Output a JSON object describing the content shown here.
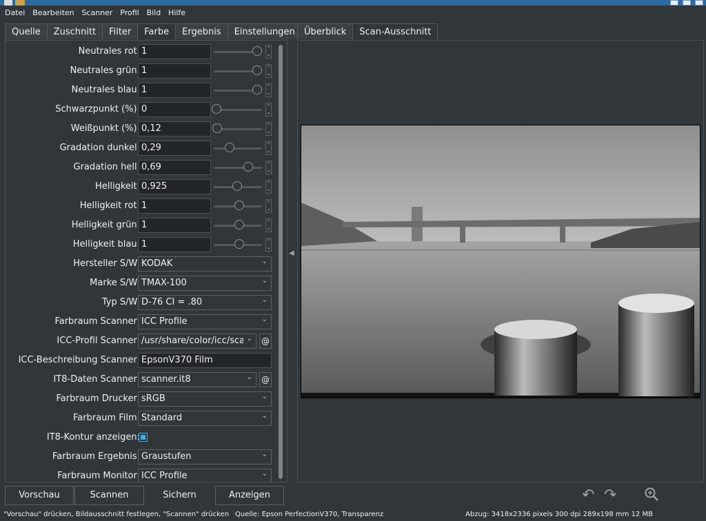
{
  "menubar": [
    "Datei",
    "Bearbeiten",
    "Scanner",
    "Profil",
    "Bild",
    "Hilfe"
  ],
  "left_tabs": [
    {
      "label": "Quelle",
      "active": false
    },
    {
      "label": "Zuschnitt",
      "active": false
    },
    {
      "label": "Filter",
      "active": false
    },
    {
      "label": "Farbe",
      "active": true
    },
    {
      "label": "Ergebnis",
      "active": false
    },
    {
      "label": "Einstellungen",
      "active": false
    }
  ],
  "right_tabs": [
    {
      "label": "Überblick",
      "active": false
    },
    {
      "label": "Scan-Ausschnitt",
      "active": true
    }
  ],
  "color": {
    "neutral_red": {
      "label": "Neutrales rot:",
      "value": "1"
    },
    "neutral_green": {
      "label": "Neutrales grün:",
      "value": "1"
    },
    "neutral_blue": {
      "label": "Neutrales blau:",
      "value": "1"
    },
    "black_point": {
      "label": "Schwarzpunkt (%):",
      "value": "0"
    },
    "white_point": {
      "label": "Weißpunkt (%):",
      "value": "0,12"
    },
    "gradation_dark": {
      "label": "Gradation dunkel:",
      "value": "0,29"
    },
    "gradation_light": {
      "label": "Gradation hell:",
      "value": "0,69"
    },
    "brightness": {
      "label": "Helligkeit:",
      "value": "0,925"
    },
    "brightness_red": {
      "label": "Helligkeit rot:",
      "value": "1"
    },
    "brightness_green": {
      "label": "Helligkeit grün:",
      "value": "1"
    },
    "brightness_blue": {
      "label": "Helligkeit blau:",
      "value": "1"
    },
    "bw_manufacturer": {
      "label": "Hersteller S/W:",
      "value": "KODAK"
    },
    "bw_brand": {
      "label": "Marke S/W:",
      "value": "TMAX-100"
    },
    "bw_type": {
      "label": "Typ S/W:",
      "value": "D-76 CI = .80"
    },
    "colorspace_scanner": {
      "label": "Farbraum Scanner:",
      "value": "ICC Profile"
    },
    "icc_profile_scanner": {
      "label": "ICC-Profil Scanner:",
      "value": "/usr/share/color/icc/scanr"
    },
    "icc_description_scanner": {
      "label": "ICC-Beschreibung Scanner:",
      "value": "EpsonV370 Film"
    },
    "it8_data_scanner": {
      "label": "IT8-Daten Scanner:",
      "value": "scanner.it8"
    },
    "colorspace_printer": {
      "label": "Farbraum Drucker:",
      "value": "sRGB"
    },
    "colorspace_film": {
      "label": "Farbraum Film:",
      "value": "Standard"
    },
    "it8_contour": {
      "label": "IT8-Kontur anzeigen:",
      "checked": true
    },
    "colorspace_result": {
      "label": "Farbraum Ergebnis:",
      "value": "Graustufen"
    },
    "colorspace_monitor": {
      "label": "Farbraum Monitor:",
      "value": "ICC Profile"
    }
  },
  "slider_levels": {
    "neutral_red": 0.9,
    "neutral_green": 0.9,
    "neutral_blue": 0.9,
    "black_point": 0.0,
    "white_point": 0.02,
    "gradation_dark": 0.29,
    "gradation_light": 0.69,
    "brightness": 0.46,
    "brightness_red": 0.5,
    "brightness_green": 0.5,
    "brightness_blue": 0.5
  },
  "at_button": "@",
  "buttons": {
    "preview": "Vorschau",
    "scan": "Scannen",
    "save": "Sichern",
    "show": "Anzeigen"
  },
  "icons": [
    "rotate-left-icon",
    "rotate-right-icon",
    "zoom-in-icon"
  ],
  "status": {
    "hint": "\"Vorschau\" drücken, Bildausschnitt festlegen, \"Scannen\" drücken",
    "source": "Quelle: Epson PerfectionV370, Transparenz",
    "print_info": "Abzug: 3418x2336 pixels 300 dpi 289x198 mm 12 MB"
  },
  "colors": {
    "background": "#31363b",
    "accent": "#3daee9",
    "field": "#232629"
  }
}
